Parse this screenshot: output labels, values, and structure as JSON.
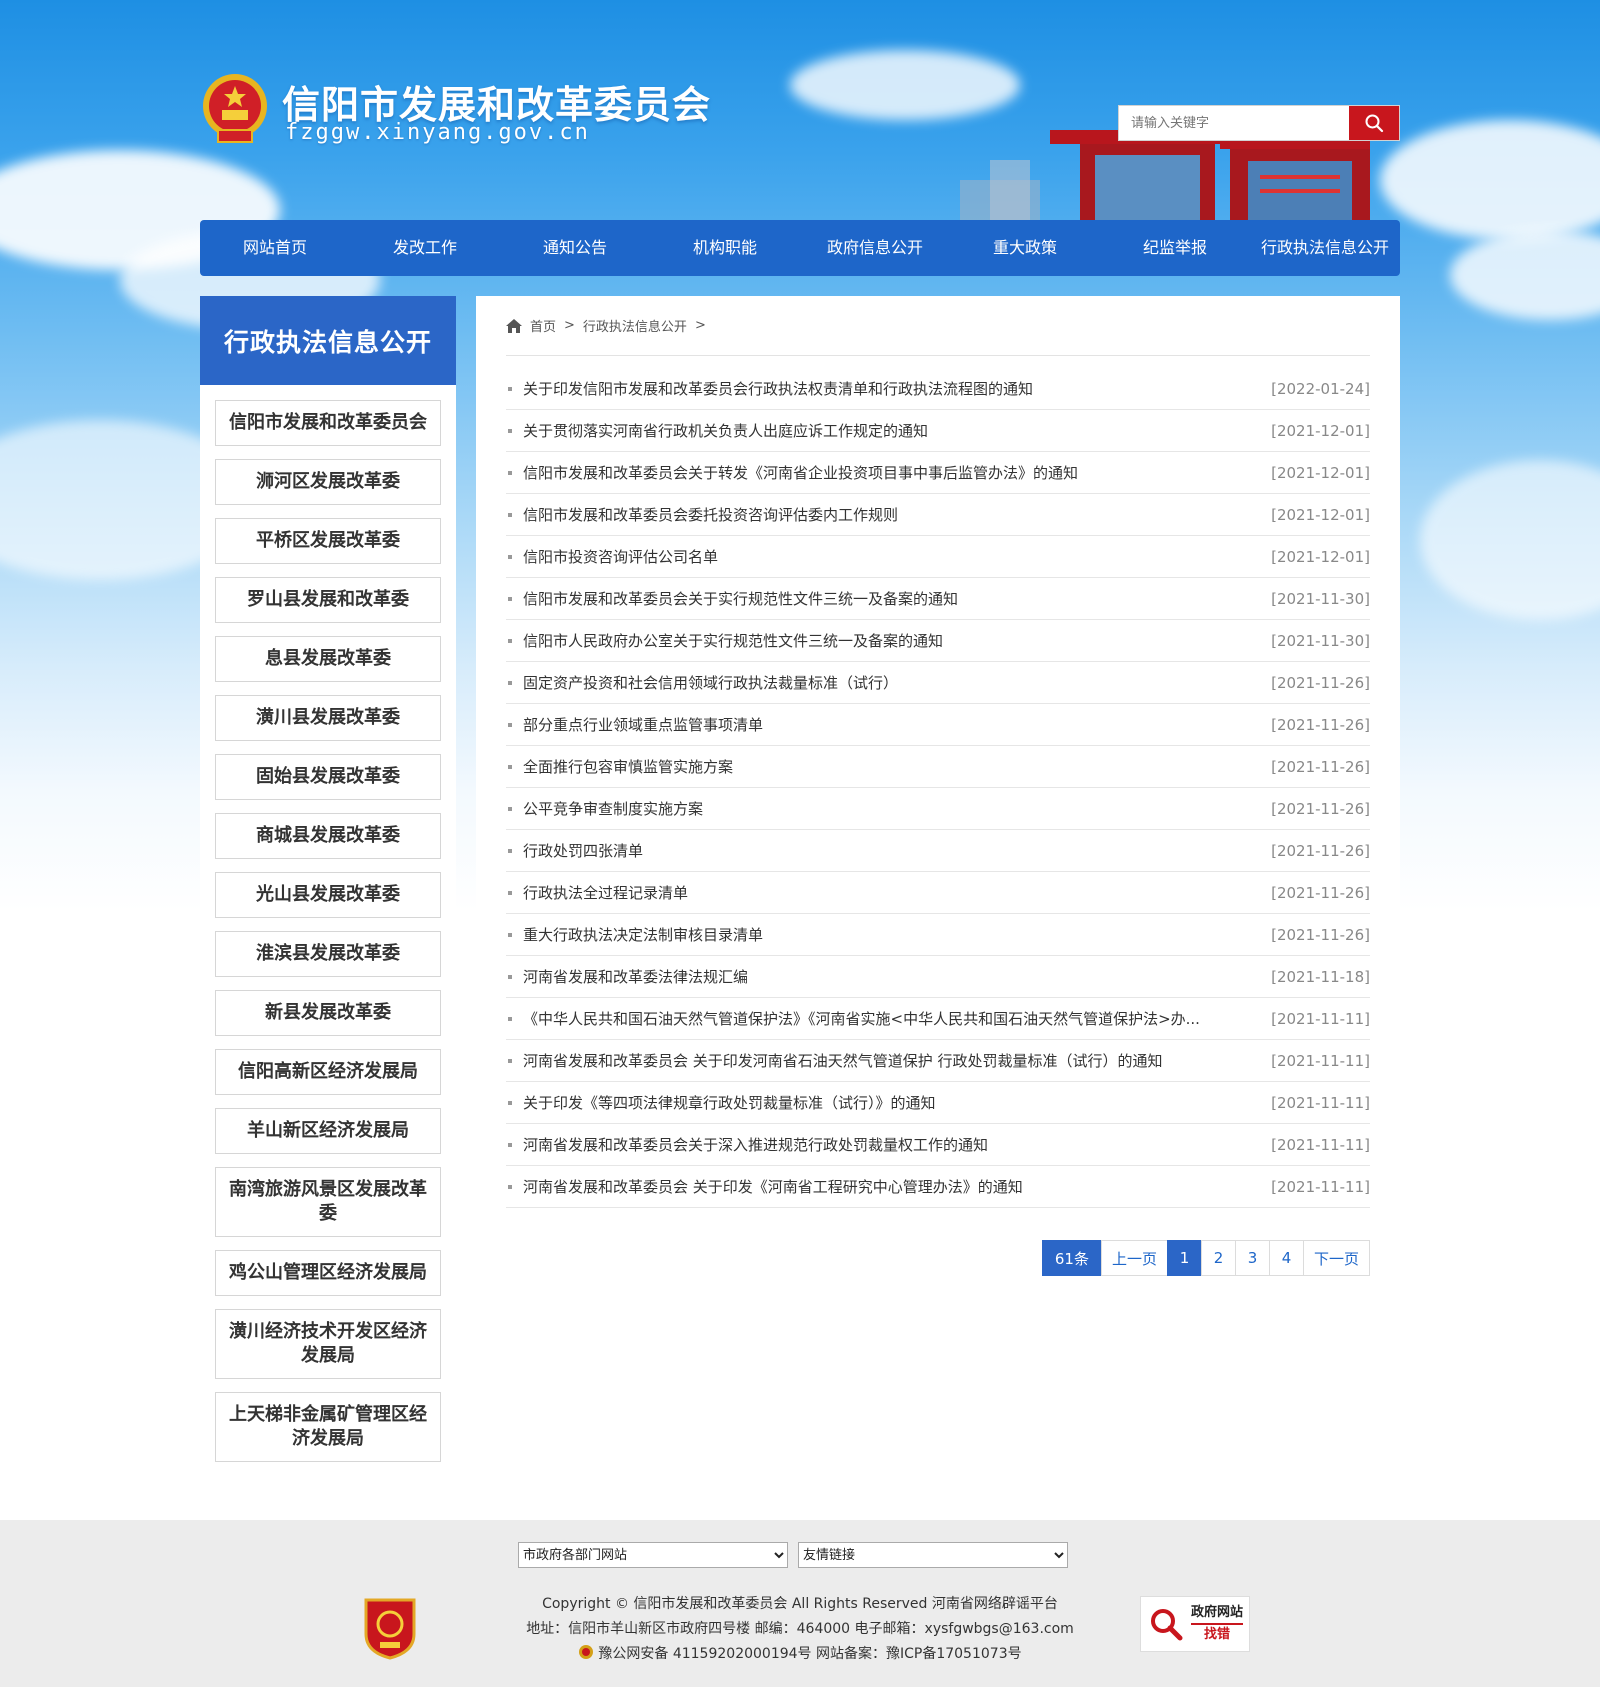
{
  "header": {
    "title": "信阳市发展和改革委员会",
    "domain": "fzggw.xinyang.gov.cn",
    "search_placeholder": "请输入关键字"
  },
  "nav": [
    "网站首页",
    "发改工作",
    "通知公告",
    "机构职能",
    "政府信息公开",
    "重大政策",
    "纪监举报",
    "行政执法信息公开"
  ],
  "sidebar": {
    "title": "行政执法信息公开",
    "items": [
      "信阳市发展和改革委员会",
      "浉河区发展改革委",
      "平桥区发展改革委",
      "罗山县发展和改革委",
      "息县发展改革委",
      "潢川县发展改革委",
      "固始县发展改革委",
      "商城县发展改革委",
      "光山县发展改革委",
      "淮滨县发展改革委",
      "新县发展改革委",
      "信阳高新区经济发展局",
      "羊山新区经济发展局",
      "南湾旅游风景区发展改革委",
      "鸡公山管理区经济发展局",
      "潢川经济技术开发区经济发展局",
      "上天梯非金属矿管理区经济发展局"
    ]
  },
  "breadcrumb": {
    "home": "首页",
    "sep1": ">",
    "current": "行政执法信息公开",
    "sep2": ">"
  },
  "articles": [
    {
      "title": "关于印发信阳市发展和改革委员会行政执法权责清单和行政执法流程图的通知",
      "date": "[2022-01-24]"
    },
    {
      "title": "关于贯彻落实河南省行政机关负责人出庭应诉工作规定的通知",
      "date": "[2021-12-01]"
    },
    {
      "title": "信阳市发展和改革委员会关于转发《河南省企业投资项目事中事后监管办法》的通知",
      "date": "[2021-12-01]"
    },
    {
      "title": "信阳市发展和改革委员会委托投资咨询评估委内工作规则",
      "date": "[2021-12-01]"
    },
    {
      "title": "信阳市投资咨询评估公司名单",
      "date": "[2021-12-01]"
    },
    {
      "title": "信阳市发展和改革委员会关于实行规范性文件三统一及备案的通知",
      "date": "[2021-11-30]"
    },
    {
      "title": "信阳市人民政府办公室关于实行规范性文件三统一及备案的通知",
      "date": "[2021-11-30]"
    },
    {
      "title": "固定资产投资和社会信用领域行政执法裁量标准（试行）",
      "date": "[2021-11-26]"
    },
    {
      "title": "部分重点行业领域重点监管事项清单",
      "date": "[2021-11-26]"
    },
    {
      "title": "全面推行包容审慎监管实施方案",
      "date": "[2021-11-26]"
    },
    {
      "title": "公平竞争审查制度实施方案",
      "date": "[2021-11-26]"
    },
    {
      "title": "行政处罚四张清单",
      "date": "[2021-11-26]"
    },
    {
      "title": "行政执法全过程记录清单",
      "date": "[2021-11-26]"
    },
    {
      "title": "重大行政执法决定法制审核目录清单",
      "date": "[2021-11-26]"
    },
    {
      "title": "河南省发展和改革委法律法规汇编",
      "date": "[2021-11-18]"
    },
    {
      "title": "《中华人民共和国石油天然气管道保护法》《河南省实施<中华人民共和国石油天然气管道保护法>办...",
      "date": "[2021-11-11]"
    },
    {
      "title": "河南省发展和改革委员会 关于印发河南省石油天然气管道保护 行政处罚裁量标准（试行）的通知",
      "date": "[2021-11-11]"
    },
    {
      "title": "关于印发《等四项法律规章行政处罚裁量标准（试行）》的通知",
      "date": "[2021-11-11]"
    },
    {
      "title": "河南省发展和改革委员会关于深入推进规范行政处罚裁量权工作的通知",
      "date": "[2021-11-11]"
    },
    {
      "title": "河南省发展和改革委员会 关于印发《河南省工程研究中心管理办法》的通知",
      "date": "[2021-11-11]"
    }
  ],
  "pager": {
    "total": "61条",
    "prev": "上一页",
    "pages": [
      "1",
      "2",
      "3",
      "4"
    ],
    "next": "下一页"
  },
  "footer": {
    "select_departments": "市政府各部门网站",
    "select_links": "友情链接",
    "copyright": "Copyright © 信阳市发展和改革委员会 All Rights Reserved 河南省网络辟谣平台",
    "address": "地址：信阳市羊山新区市政府四号楼 邮编：464000 电子邮箱：xysfgwbgs@163.com",
    "icp": "豫公网安备 41159202000194号 网站备案：豫ICP备17051073号",
    "badge_top": "政府网站",
    "badge_bottom": "找错"
  },
  "colors": {
    "nav_blue": "#1e66c9",
    "accent_blue": "#2b66c7",
    "search_red": "#c8161d"
  }
}
